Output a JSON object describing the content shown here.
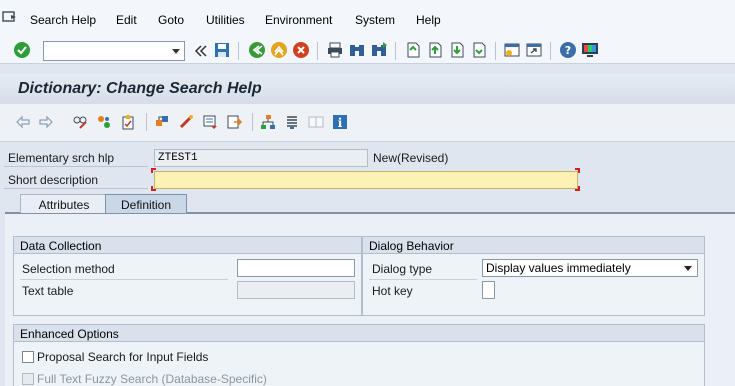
{
  "menu": {
    "items": [
      "Search Help",
      "Edit",
      "Goto",
      "Utilities",
      "Environment",
      "System",
      "Help"
    ]
  },
  "toolbar": {
    "command_field_value": "",
    "icons": [
      "enter-icon",
      "save-icon",
      "back-icon",
      "exit-icon",
      "cancel-icon",
      "print-icon",
      "find-icon",
      "find-next-icon",
      "first-page-icon",
      "previous-page-icon",
      "next-page-icon",
      "last-page-icon",
      "new-session-icon",
      "shortcut-icon",
      "help-icon",
      "customize-layout-icon"
    ]
  },
  "title": "Dictionary: Change Search Help",
  "app_toolbar": {
    "icons": [
      "back-arrow-icon",
      "forward-arrow-icon",
      "display-change-icon",
      "other-object-icon",
      "check-icon",
      "activate-icon",
      "where-used-icon",
      "display-object-list-icon",
      "navigation-window-icon",
      "hierarchy-icon",
      "test-icon",
      "documentation-icon",
      "info-icon"
    ]
  },
  "header_fields": {
    "search_help_label": "Elementary srch hlp",
    "search_help_value": "ZTEST1",
    "status_text": "New(Revised)",
    "short_description_label": "Short description",
    "short_description_value": ""
  },
  "tabs": [
    {
      "label": "Attributes",
      "active": false
    },
    {
      "label": "Definition",
      "active": true
    }
  ],
  "data_collection": {
    "title": "Data Collection",
    "selection_method_label": "Selection method",
    "selection_method_value": "",
    "text_table_label": "Text table",
    "text_table_value": ""
  },
  "dialog_behavior": {
    "title": "Dialog Behavior",
    "dialog_type_label": "Dialog type",
    "dialog_type_value": "Display values immediately",
    "hot_key_label": "Hot key",
    "hot_key_value": ""
  },
  "enhanced_options": {
    "title": "Enhanced Options",
    "proposal_search_label": "Proposal Search for Input Fields",
    "proposal_search_checked": false,
    "fuzzy_search_label": "Full Text Fuzzy Search (Database-Specific)",
    "fuzzy_search_checked": false,
    "fuzzy_search_enabled": false
  },
  "colors": {
    "accent": "#0a6ed1",
    "required_field": "#fdf1b4",
    "title_text": "#1a2733"
  }
}
